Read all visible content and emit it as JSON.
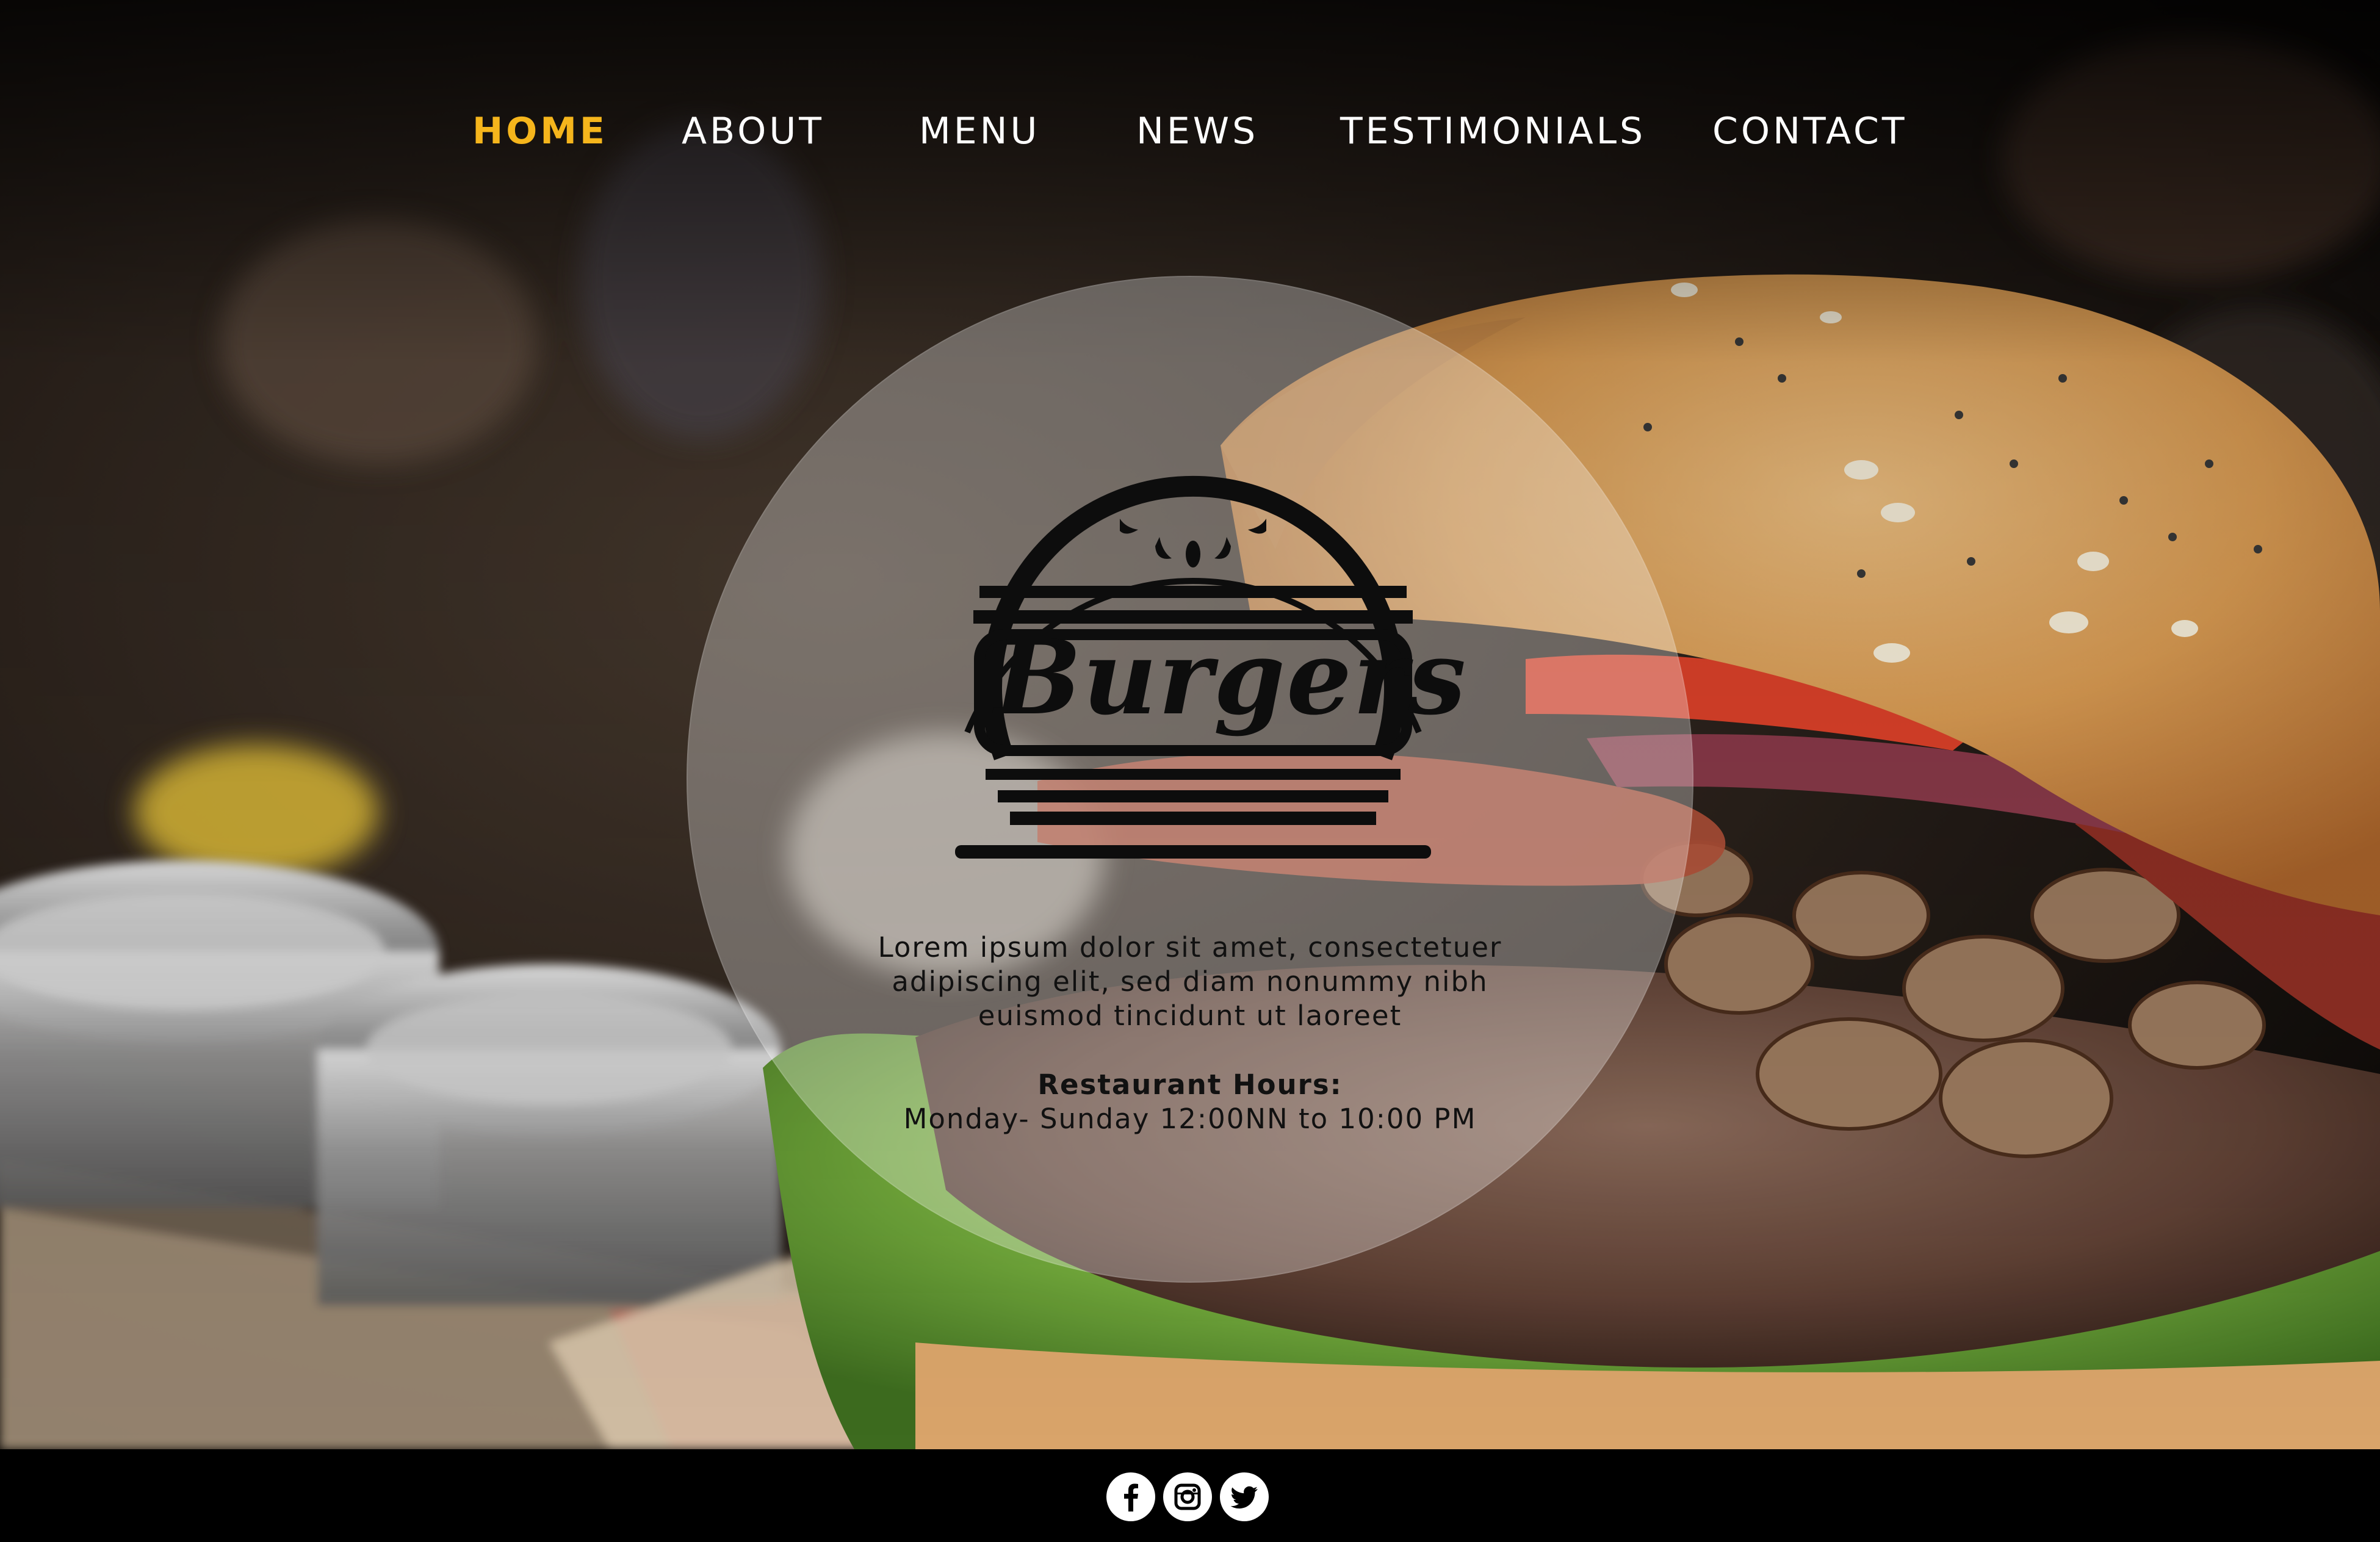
{
  "nav": {
    "items": [
      {
        "label": "HOME",
        "active": true
      },
      {
        "label": "ABOUT",
        "active": false
      },
      {
        "label": "MENU",
        "active": false
      },
      {
        "label": "NEWS",
        "active": false
      },
      {
        "label": "TESTIMONIALS",
        "active": false
      },
      {
        "label": "CONTACT",
        "active": false
      }
    ]
  },
  "hero": {
    "logo_text": "Burgers",
    "intro_lines": [
      "Lorem ipsum dolor sit amet, consectetuer",
      "adipiscing elit, sed diam nonummy nibh",
      "euismod tincidunt ut laoreet"
    ],
    "hours_title": "Restaurant Hours:",
    "hours_text": "Monday- Sunday 12:00NN to 10:00 PM"
  },
  "footer": {
    "social": [
      {
        "icon": "facebook-icon"
      },
      {
        "icon": "instagram-icon"
      },
      {
        "icon": "twitter-icon"
      }
    ]
  },
  "colors": {
    "accent": "#f5b51c",
    "nav_text": "#ffffff",
    "footer_bg": "#000000",
    "body_text": "#111111"
  }
}
